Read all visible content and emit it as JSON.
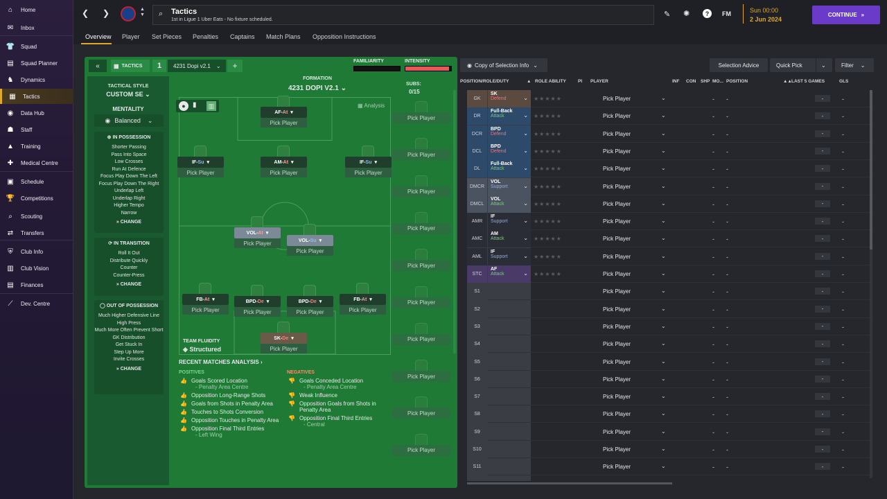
{
  "sidebar": {
    "items": [
      {
        "label": "Home",
        "icon": "home-icon",
        "glyph": "⌂"
      },
      {
        "label": "Inbox",
        "icon": "inbox-icon",
        "glyph": "✉"
      },
      {
        "label": "Squad",
        "icon": "shirt-icon",
        "glyph": "👕"
      },
      {
        "label": "Squad Planner",
        "icon": "planner-icon",
        "glyph": "▤"
      },
      {
        "label": "Dynamics",
        "icon": "dynamics-icon",
        "glyph": "♞"
      },
      {
        "label": "Tactics",
        "icon": "tactics-icon",
        "glyph": "▦"
      },
      {
        "label": "Data Hub",
        "icon": "data-hub-icon",
        "glyph": "◉"
      },
      {
        "label": "Staff",
        "icon": "staff-icon",
        "glyph": "☗"
      },
      {
        "label": "Training",
        "icon": "training-icon",
        "glyph": "▲"
      },
      {
        "label": "Medical Centre",
        "icon": "medical-icon",
        "glyph": "✚"
      },
      {
        "label": "Schedule",
        "icon": "calendar-icon",
        "glyph": "▣"
      },
      {
        "label": "Competitions",
        "icon": "trophy-icon",
        "glyph": "🏆"
      },
      {
        "label": "Scouting",
        "icon": "scouting-icon",
        "glyph": "⌕"
      },
      {
        "label": "Transfers",
        "icon": "transfers-icon",
        "glyph": "⇄"
      },
      {
        "label": "Club Info",
        "icon": "shield-icon",
        "glyph": "⛨"
      },
      {
        "label": "Club Vision",
        "icon": "vision-icon",
        "glyph": "▥"
      },
      {
        "label": "Finances",
        "icon": "finances-icon",
        "glyph": "▤"
      },
      {
        "label": "Dev. Centre",
        "icon": "dev-centre-icon",
        "glyph": "⟋"
      }
    ]
  },
  "header": {
    "title": "Tactics",
    "subtitle": "1st in Ligue 1 Uber Eats - No fixture scheduled.",
    "time": "Sun 00:00",
    "date": "2 Jun 2024",
    "continue_label": "CONTINUE",
    "fm_label": "FM"
  },
  "tabs": [
    "Overview",
    "Player",
    "Set Pieces",
    "Penalties",
    "Captains",
    "Match Plans",
    "Opposition Instructions"
  ],
  "tactic": {
    "tactics_label": "TACTICS",
    "slot_number": "1",
    "name": "4231 Dopi v2.1",
    "familiarity_label": "FAMILIARITY",
    "intensity_label": "INTENSITY",
    "familiarity_level": 1.0,
    "intensity_level": 0.95,
    "style_label": "TACTICAL STYLE",
    "style_value": "CUSTOM SE",
    "mentality_label": "MENTALITY",
    "mentality_value": "Balanced",
    "in_possession_title": "IN POSSESSION",
    "in_possession": [
      "Shorter Passing",
      "Pass Into Space",
      "Low Crosses",
      "Run At Defence",
      "Focus Play Down The Left",
      "Focus Play Down The Right",
      "Underlap Left",
      "Underlap Right",
      "Higher Tempo",
      "Narrow"
    ],
    "in_transition_title": "IN TRANSITION",
    "in_transition": [
      "Roll It Out",
      "Distribute Quickly",
      "Counter",
      "Counter-Press"
    ],
    "out_possession_title": "OUT OF POSSESSION",
    "out_possession": [
      "Much Higher Defensive Line",
      "High Press",
      "Much More Often Prevent Short GK Distribution",
      "Get Stuck In",
      "Step Up More",
      "Invite Crosses"
    ],
    "change_label": "CHANGE"
  },
  "pitch": {
    "formation_label": "FORMATION",
    "formation_value": "4231 DOPI V2.1",
    "analysis_label": "Analysis",
    "pick_player": "Pick Player",
    "subs_label": "SUBS:",
    "subs_count": "0/15",
    "players": [
      {
        "role": "AF",
        "duty": "At",
        "duty_color": "#ff9a9a"
      },
      {
        "role": "IF",
        "duty": "Su",
        "duty_color": "#8fb8ff"
      },
      {
        "role": "AM",
        "duty": "At",
        "duty_color": "#ff9a9a"
      },
      {
        "role": "IF",
        "duty": "Su",
        "duty_color": "#8fb8ff"
      },
      {
        "role": "VOL",
        "duty": "At",
        "duty_color": "#ff9a9a"
      },
      {
        "role": "VOL",
        "duty": "Su",
        "duty_color": "#8fb8ff"
      },
      {
        "role": "FB",
        "duty": "At",
        "duty_color": "#ff9a9a"
      },
      {
        "role": "BPD",
        "duty": "De",
        "duty_color": "#ff7a7a"
      },
      {
        "role": "BPD",
        "duty": "De",
        "duty_color": "#ff7a7a"
      },
      {
        "role": "FB",
        "duty": "At",
        "duty_color": "#ff9a9a"
      },
      {
        "role": "SK",
        "duty": "De",
        "duty_color": "#ff7a7a"
      }
    ],
    "fluidity_label": "TEAM FLUIDITY",
    "fluidity_value": "Structured"
  },
  "analysis": {
    "title": "RECENT MATCHES ANALYSIS",
    "positives_label": "POSITIVES",
    "negatives_label": "NEGATIVES",
    "positives": [
      {
        "text": "Goals Scored Location",
        "sub": "- Penalty Area Centre"
      },
      {
        "text": "Opposition Long-Range Shots",
        "sub": ""
      },
      {
        "text": "Goals from Shots in Penalty Area",
        "sub": ""
      },
      {
        "text": "Touches to Shots Conversion",
        "sub": ""
      },
      {
        "text": "Opposition Touches in Penalty Area",
        "sub": ""
      },
      {
        "text": "Opposition Final Third Entries",
        "sub": "- Left Wing"
      }
    ],
    "negatives": [
      {
        "text": "Goals Conceded Location",
        "sub": "- Penalty Area Centre"
      },
      {
        "text": "Weak Influence",
        "sub": ""
      },
      {
        "text": "Opposition Goals from Shots in Penalty Area",
        "sub": ""
      },
      {
        "text": "Opposition Final Third Entries",
        "sub": "- Central"
      }
    ]
  },
  "right": {
    "copy_btn": "Copy of Selection Info",
    "selection_advice": "Selection Advice",
    "quick_pick": "Quick Pick",
    "filter": "Filter",
    "columns": {
      "position": "POSITION/ROLE/DUTY",
      "role_ability": "ROLE ABILITY",
      "pi": "PI",
      "player": "PLAYER",
      "inf": "INF",
      "con": "CON",
      "shp": "SHP",
      "mo": "MO...",
      "pos": "POSITION",
      "last5": "LAST 5 GAMES",
      "gls": "GLS"
    },
    "rows": [
      {
        "pos": "GK",
        "role": "SK",
        "duty": "Defend",
        "bg": "#5a4a40",
        "duty_color": "#ff6b6b"
      },
      {
        "pos": "DR",
        "role": "Full-Back",
        "duty": "Attack",
        "bg": "#2e4a6a",
        "duty_color": "#6fd36f"
      },
      {
        "pos": "DCR",
        "role": "BPD",
        "duty": "Defend",
        "bg": "#2e4a6a",
        "duty_color": "#ff6b6b"
      },
      {
        "pos": "DCL",
        "role": "BPD",
        "duty": "Defend",
        "bg": "#2e4a6a",
        "duty_color": "#ff6b6b"
      },
      {
        "pos": "DL",
        "role": "Full-Back",
        "duty": "Attack",
        "bg": "#2e4a6a",
        "duty_color": "#6fd36f"
      },
      {
        "pos": "DMCR",
        "role": "VOL",
        "duty": "Support",
        "bg": "#4c5360",
        "duty_color": "#7ab0ff"
      },
      {
        "pos": "DMCL",
        "role": "VOL",
        "duty": "Attack",
        "bg": "#4c5360",
        "duty_color": "#6fd36f"
      },
      {
        "pos": "AMR",
        "role": "IF",
        "duty": "Support",
        "bg": "#2a2d35",
        "duty_color": "#7ab0ff"
      },
      {
        "pos": "AMC",
        "role": "AM",
        "duty": "Attack",
        "bg": "#2a2d35",
        "duty_color": "#6fd36f"
      },
      {
        "pos": "AML",
        "role": "IF",
        "duty": "Support",
        "bg": "#2a2d35",
        "duty_color": "#7ab0ff"
      },
      {
        "pos": "STC",
        "role": "AF",
        "duty": "Attack",
        "bg": "#4a3a68",
        "duty_color": "#6fd36f"
      },
      {
        "pos": "S1",
        "role": "",
        "duty": "",
        "bg": "#3a3d44",
        "duty_color": ""
      },
      {
        "pos": "S2",
        "role": "",
        "duty": "",
        "bg": "#3a3d44",
        "duty_color": ""
      },
      {
        "pos": "S3",
        "role": "",
        "duty": "",
        "bg": "#3a3d44",
        "duty_color": ""
      },
      {
        "pos": "S4",
        "role": "",
        "duty": "",
        "bg": "#3a3d44",
        "duty_color": ""
      },
      {
        "pos": "S5",
        "role": "",
        "duty": "",
        "bg": "#3a3d44",
        "duty_color": ""
      },
      {
        "pos": "S6",
        "role": "",
        "duty": "",
        "bg": "#3a3d44",
        "duty_color": ""
      },
      {
        "pos": "S7",
        "role": "",
        "duty": "",
        "bg": "#3a3d44",
        "duty_color": ""
      },
      {
        "pos": "S8",
        "role": "",
        "duty": "",
        "bg": "#3a3d44",
        "duty_color": ""
      },
      {
        "pos": "S9",
        "role": "",
        "duty": "",
        "bg": "#3a3d44",
        "duty_color": ""
      },
      {
        "pos": "S10",
        "role": "",
        "duty": "",
        "bg": "#3a3d44",
        "duty_color": ""
      },
      {
        "pos": "S11",
        "role": "",
        "duty": "",
        "bg": "#3a3d44",
        "duty_color": ""
      }
    ],
    "pick_player": "Pick Player",
    "dash": "-"
  }
}
